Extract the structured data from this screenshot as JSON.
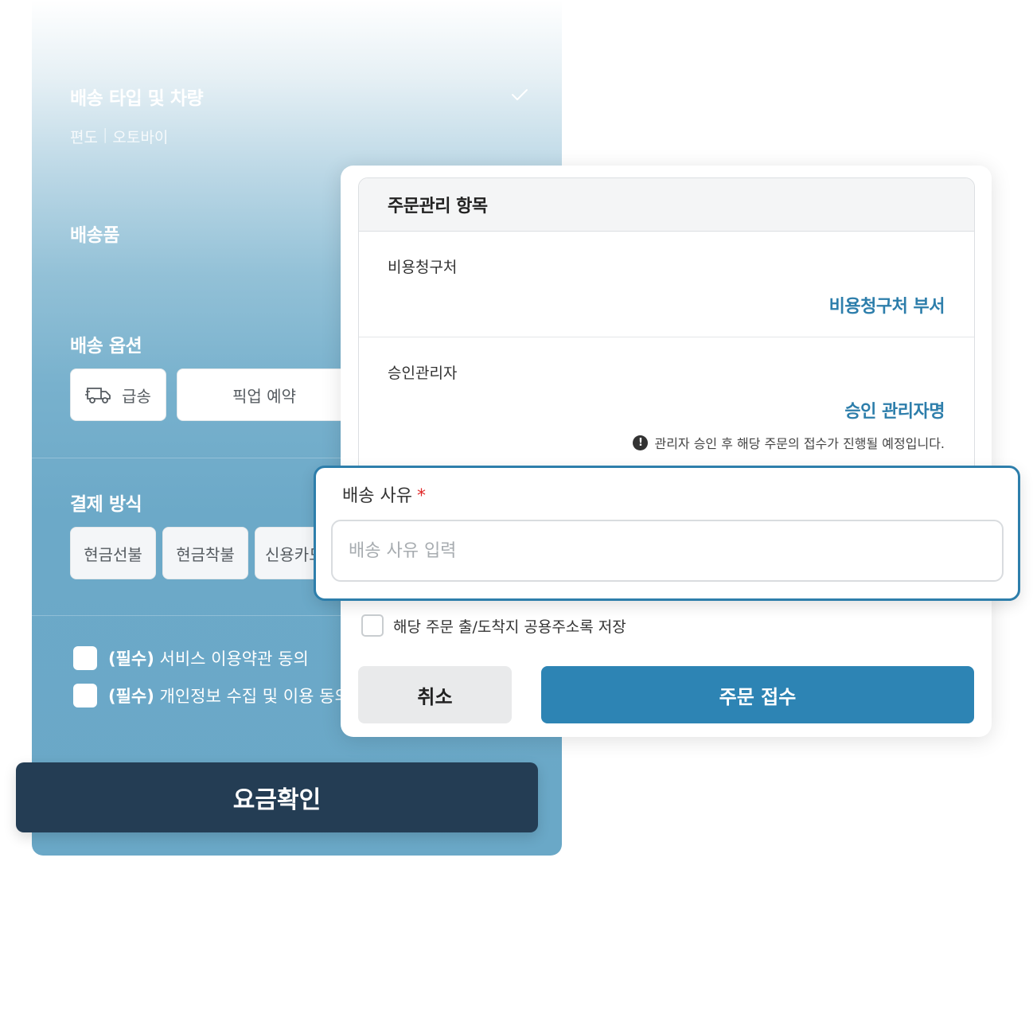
{
  "order_form": {
    "delivery_type": {
      "title": "배송 타입 및 차량",
      "value_oneway": "편도",
      "separator": "|",
      "value_vehicle": "오토바이"
    },
    "item": {
      "title": "배송품"
    },
    "options": {
      "title": "배송 옵션",
      "express_label": "급송",
      "pickup_label": "픽업 예약"
    },
    "payment": {
      "title": "결제 방식",
      "methods": [
        "현금선불",
        "현금착불",
        "신용카드"
      ]
    },
    "agreements": [
      {
        "tag": "(필수)",
        "text": "서비스 이용약관 동의"
      },
      {
        "tag": "(필수)",
        "text": "개인정보 수집 및 이용 동의"
      }
    ],
    "fee_button": "요금확인"
  },
  "modal": {
    "mgmt_title": "주문관리 항목",
    "billing": {
      "label": "비용청구처",
      "value": "비용청구처 부서"
    },
    "approver": {
      "label": "승인관리자",
      "value": "승인 관리자명",
      "notice_icon": "!",
      "notice": "관리자 승인 후 해당 주문의 접수가 진행될 예정입니다."
    },
    "reason": {
      "label": "배송 사유",
      "required_mark": "*",
      "placeholder": "배송 사유 입력"
    },
    "save_address_label": "해당 주문 출/도착지 공용주소록 저장",
    "cancel_button": "취소",
    "submit_button": "주문 접수"
  },
  "colors": {
    "accent": "#2d84b4",
    "dark_button": "#243d54",
    "required": "#e02a2a"
  }
}
